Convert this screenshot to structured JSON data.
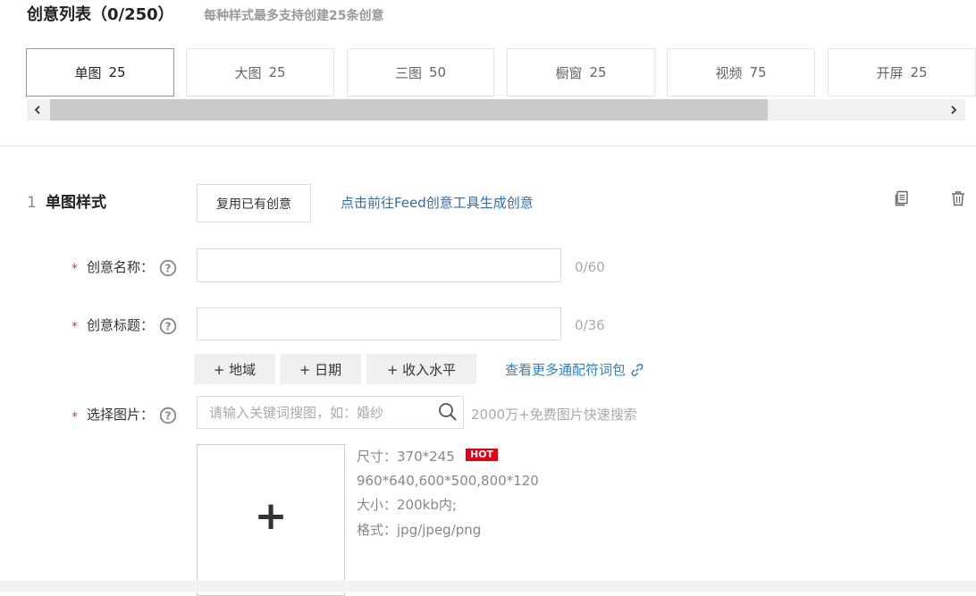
{
  "header": {
    "title": "创意列表（0/250）",
    "subtitle": "每种样式最多支持创建25条创意"
  },
  "style_tabs": [
    {
      "name": "单图",
      "count": "25",
      "active": true
    },
    {
      "name": "大图",
      "count": "25",
      "active": false
    },
    {
      "name": "三图",
      "count": "50",
      "active": false
    },
    {
      "name": "橱窗",
      "count": "25",
      "active": false
    },
    {
      "name": "视频",
      "count": "75",
      "active": false
    },
    {
      "name": "开屏",
      "count": "25",
      "active": false
    }
  ],
  "section": {
    "number": "1",
    "title": "单图样式",
    "reuse_button": "复用已有创意",
    "feed_link": "点击前往Feed创意工具生成创意",
    "copy_icon": "copy-icon",
    "delete_icon": "trash-icon"
  },
  "form": {
    "name": {
      "required_mark": "*",
      "label": "创意名称：",
      "value": "",
      "counter": "0/60"
    },
    "title": {
      "required_mark": "*",
      "label": "创意标题：",
      "value": "",
      "counter": "0/36"
    },
    "wildcards": [
      "+ 地域",
      "+ 日期",
      "+ 收入水平"
    ],
    "more_wildcards_link": "查看更多通配符词包",
    "image": {
      "required_mark": "*",
      "label": "选择图片：",
      "search_placeholder": "请输入关键词搜图，如：婚纱",
      "search_hint": "2000万+免费图片快速搜索",
      "upload_plus": "+",
      "spec_size": "尺寸：370*245",
      "hot_badge": "HOT",
      "spec_sizes_alt": "960*640,600*500,800*120",
      "spec_filesize": "大小：200kb内;",
      "spec_format": "格式：jpg/jpeg/png"
    }
  },
  "colors": {
    "link": "#2f6bbf",
    "required": "#e03b3b",
    "hot": "#e60012"
  }
}
